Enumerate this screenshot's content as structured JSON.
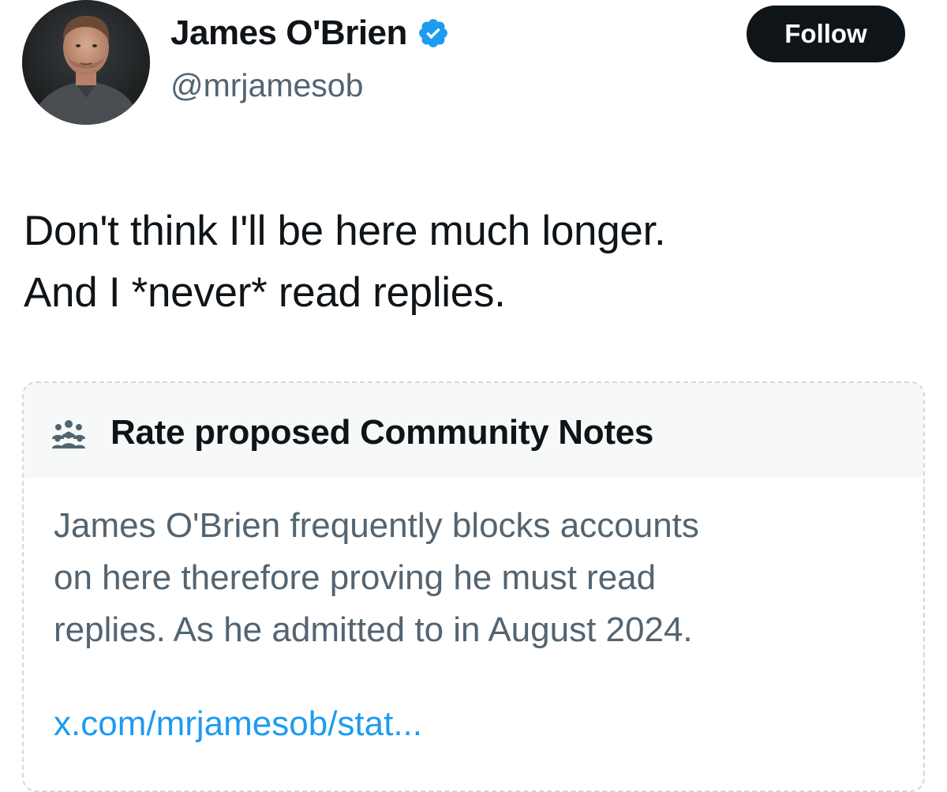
{
  "profile": {
    "display_name": "James O'Brien",
    "handle": "@mrjamesob",
    "verified": true,
    "avatar": "avatar-photo",
    "verified_icon": "verified-badge-icon",
    "follow_label": "Follow"
  },
  "post": {
    "lines": [
      "Don't think I'll be here much longer.",
      "And I *never* read replies."
    ]
  },
  "community_notes": {
    "icon": "people-icon",
    "title": "Rate proposed Community Notes",
    "body_lines": [
      "James O'Brien frequently blocks accounts",
      "on here therefore proving he must read",
      "replies. As he admitted to in August 2024."
    ],
    "link_text": "x.com/mrjamesob/stat..."
  },
  "colors": {
    "text_primary": "#0f1419",
    "text_secondary": "#536471",
    "link": "#1d9bf0",
    "verified": "#1d9bf0",
    "follow_bg": "#0f1419",
    "notes_header_bg": "#f7f9f9",
    "card_border": "#cfd9de"
  }
}
